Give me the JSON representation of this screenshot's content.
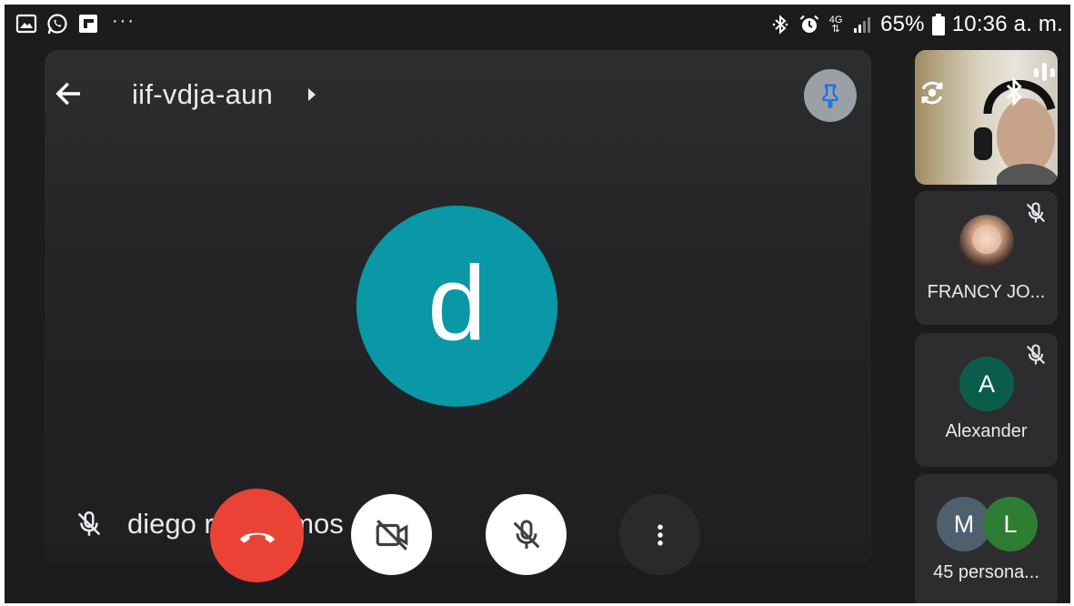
{
  "status_bar": {
    "notification_icons": [
      "gallery-icon",
      "whatsapp-icon",
      "flipboard-icon"
    ],
    "more_dots": "···",
    "right_icons": [
      "bluetooth-icon",
      "alarm-icon",
      "network-4g-icon",
      "signal-icon",
      "battery-icon"
    ],
    "network_label": "4G",
    "battery": "65%",
    "time": "10:36 a. m."
  },
  "header": {
    "meeting_code": "iif-vdja-aun"
  },
  "main_speaker": {
    "avatar_letter": "d",
    "avatar_color": "#0a97a6",
    "name": "diego       ramos mos"
  },
  "controls": {
    "end_call_color": "#ea4335"
  },
  "tiles": [
    {
      "kind": "self-video"
    },
    {
      "name": "FRANCY JO...",
      "muted": true
    },
    {
      "name": "Alexander",
      "avatar_letter": "A",
      "avatar_color": "#0b5d4b",
      "muted": true
    },
    {
      "name": "45 persona...",
      "avatar_letters": [
        "M",
        "L"
      ],
      "avatar_colors": [
        "#4e5f6e",
        "#2f7d32"
      ]
    }
  ]
}
